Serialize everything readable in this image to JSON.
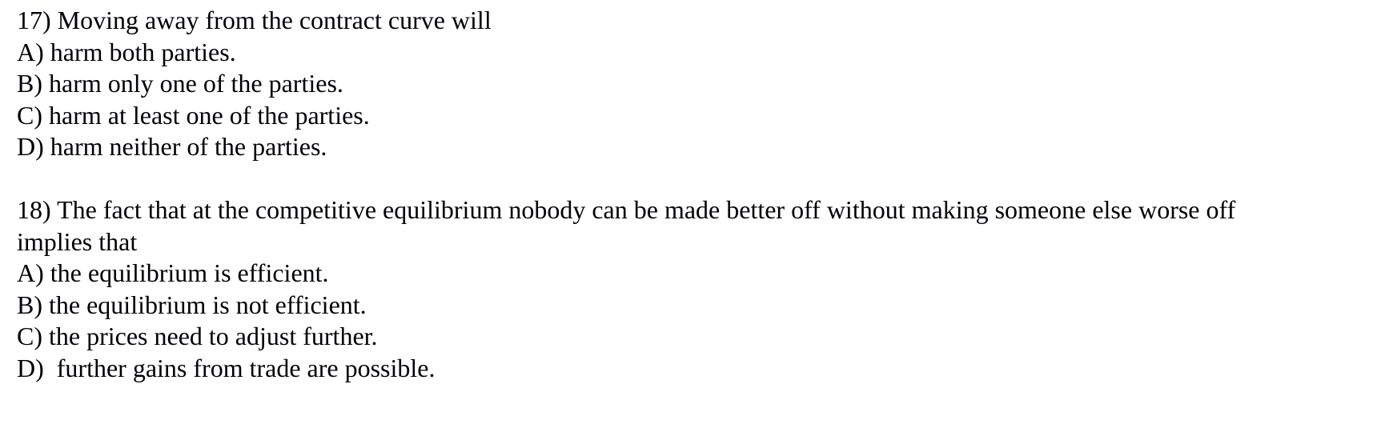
{
  "document": {
    "background_color": "#ffffff",
    "text_color": "#000000",
    "questions": [
      {
        "number": "17)",
        "stem": "17) Moving away from the contract curve will",
        "choices": [
          {
            "letter": "A)",
            "text": "A) harm both parties."
          },
          {
            "letter": "B)",
            "text": "B) harm only one of the parties."
          },
          {
            "letter": "C)",
            "text": "C) harm at least one of the parties."
          },
          {
            "letter": "D)",
            "text": "D) harm neither of the parties."
          }
        ]
      },
      {
        "number": "18)",
        "stem": "18) The fact that at the competitive equilibrium nobody can be made better off without making someone else worse off implies that",
        "choices": [
          {
            "letter": "A)",
            "text": "A) the equilibrium is efficient."
          },
          {
            "letter": "B)",
            "text": "B) the equilibrium is not efficient."
          },
          {
            "letter": "C)",
            "text": "C) the prices need to adjust further."
          },
          {
            "letter": "D)",
            "text": "D)  further gains from trade are possible."
          }
        ]
      }
    ]
  }
}
